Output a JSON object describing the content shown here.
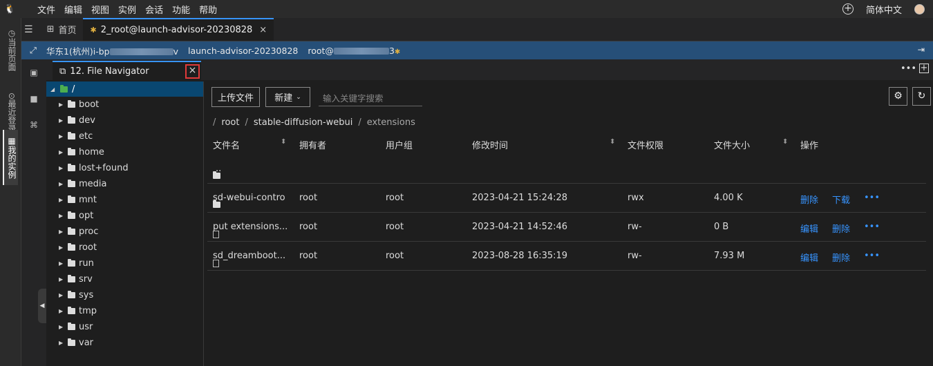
{
  "menubar": {
    "items": [
      "文件",
      "编辑",
      "视图",
      "实例",
      "会话",
      "功能",
      "帮助"
    ],
    "language": "简体中文"
  },
  "rail": {
    "tabs": [
      "当前页面",
      "最近登录",
      "我的实例"
    ]
  },
  "tabs": {
    "home": "首页",
    "session": "2_root@launch-advisor-20230828"
  },
  "infobar": {
    "region": "华东1(杭州)i-bp",
    "region_suffix": "v",
    "instance_name": "launch-advisor-20230828",
    "user": "root@",
    "user_suffix": "3"
  },
  "plugin_tab": {
    "label": "12. File Navigator",
    "close": "×"
  },
  "tree": {
    "root": "/",
    "items": [
      "boot",
      "dev",
      "etc",
      "home",
      "lost+found",
      "media",
      "mnt",
      "opt",
      "proc",
      "root",
      "run",
      "srv",
      "sys",
      "tmp",
      "usr",
      "var"
    ]
  },
  "toolbar": {
    "upload": "上传文件",
    "new": "新建",
    "search_placeholder": "输入关键字搜索"
  },
  "breadcrumb": [
    "root",
    "stable-diffusion-webui",
    "extensions"
  ],
  "table": {
    "headers": [
      "文件名",
      "拥有者",
      "用户组",
      "修改时间",
      "文件权限",
      "文件大小",
      "操作"
    ],
    "parent": "..",
    "rows": [
      {
        "type": "folder",
        "name": "sd-webui-contro",
        "owner": "root",
        "group": "root",
        "mtime": "2023-04-21 15:24:28",
        "perm": "rwx",
        "size": "4.00 K",
        "actions": [
          "删除",
          "下载"
        ]
      },
      {
        "type": "file",
        "name": "put extensions...",
        "owner": "root",
        "group": "root",
        "mtime": "2023-04-21 14:52:46",
        "perm": "rw-",
        "size": "0 B",
        "actions": [
          "编辑",
          "删除"
        ]
      },
      {
        "type": "file",
        "name": "sd_dreamboot...",
        "owner": "root",
        "group": "root",
        "mtime": "2023-08-28 16:35:19",
        "perm": "rw-",
        "size": "7.93 M",
        "actions": [
          "编辑",
          "删除"
        ]
      }
    ],
    "more": "•••"
  }
}
